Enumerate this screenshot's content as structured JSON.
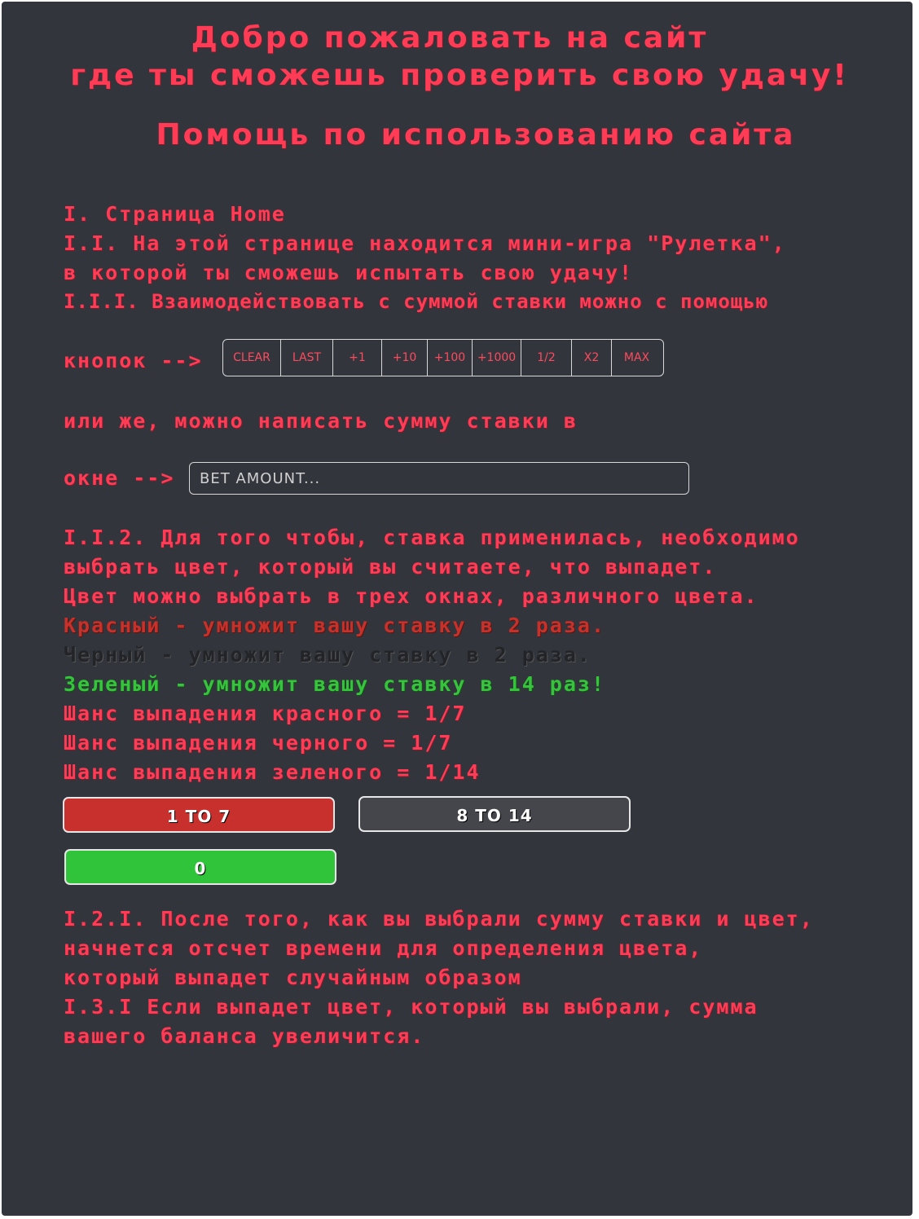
{
  "header": {
    "welcome_line1": "Добро пожаловать на сайт",
    "welcome_line2": "где ты сможешь  проверить свою удачу!",
    "help_title": "Помощь по использованию сайта"
  },
  "section1": {
    "heading": "I. Страница Home",
    "l11a": "I.I. На этой странице находится мини-игра \"Рулетка\",",
    "l11b": "в которой ты сможешь испытать свою удачу!",
    "l111": "I.I.I. Взаимодействовать с суммой ставки можно с помощью",
    "buttons_prefix": "кнопок -->",
    "or_write": "или же, можно написать сумму ставки в",
    "window_prefix": "окне -->"
  },
  "bet_buttons": [
    "CLEAR",
    "LAST",
    "+1",
    "+10",
    "+100",
    "+1000",
    "1/2",
    "X2",
    "MAX"
  ],
  "bet_input": {
    "placeholder": "BET AMOUNT..."
  },
  "section112": {
    "l1": "I.I.2. Для того чтобы, ставка применилась, необходимо",
    "l2": "выбрать цвет, который вы считаете, что выпадет.",
    "l3": "Цвет можно выбрать в трех окнах, различного цвета.",
    "red": "Красный - умножит вашу ставку в 2 раза.",
    "black": "Черный - умножит вашу ставку в  2 раза.",
    "green": "Зеленый - умножит вашу ставку в 14 раз!",
    "chance_red": "Шанс выпадения красного = 1/7",
    "chance_black": "Шанс выпадения черного = 1/7",
    "chance_green": "Шанс выпадения зеленого = 1/14"
  },
  "color_buttons": {
    "red": "1 TO 7",
    "black": "8 TO 14",
    "green": "0"
  },
  "section121": {
    "l1": "I.2.I. После того, как вы выбрали сумму ставки и цвет,",
    "l2": "начнется отсчет времени для определения цвета,",
    "l3": "который выпадет случайным образом",
    "l4": "I.3.I Если выпадет цвет, который вы выбрали, сумма",
    "l5": "вашего баланса увеличится."
  },
  "colors": {
    "panel": "#33353c",
    "text_accent": "#ff3b55",
    "red": "#c7302c",
    "black": "#45464b",
    "green": "#2fc43a"
  }
}
